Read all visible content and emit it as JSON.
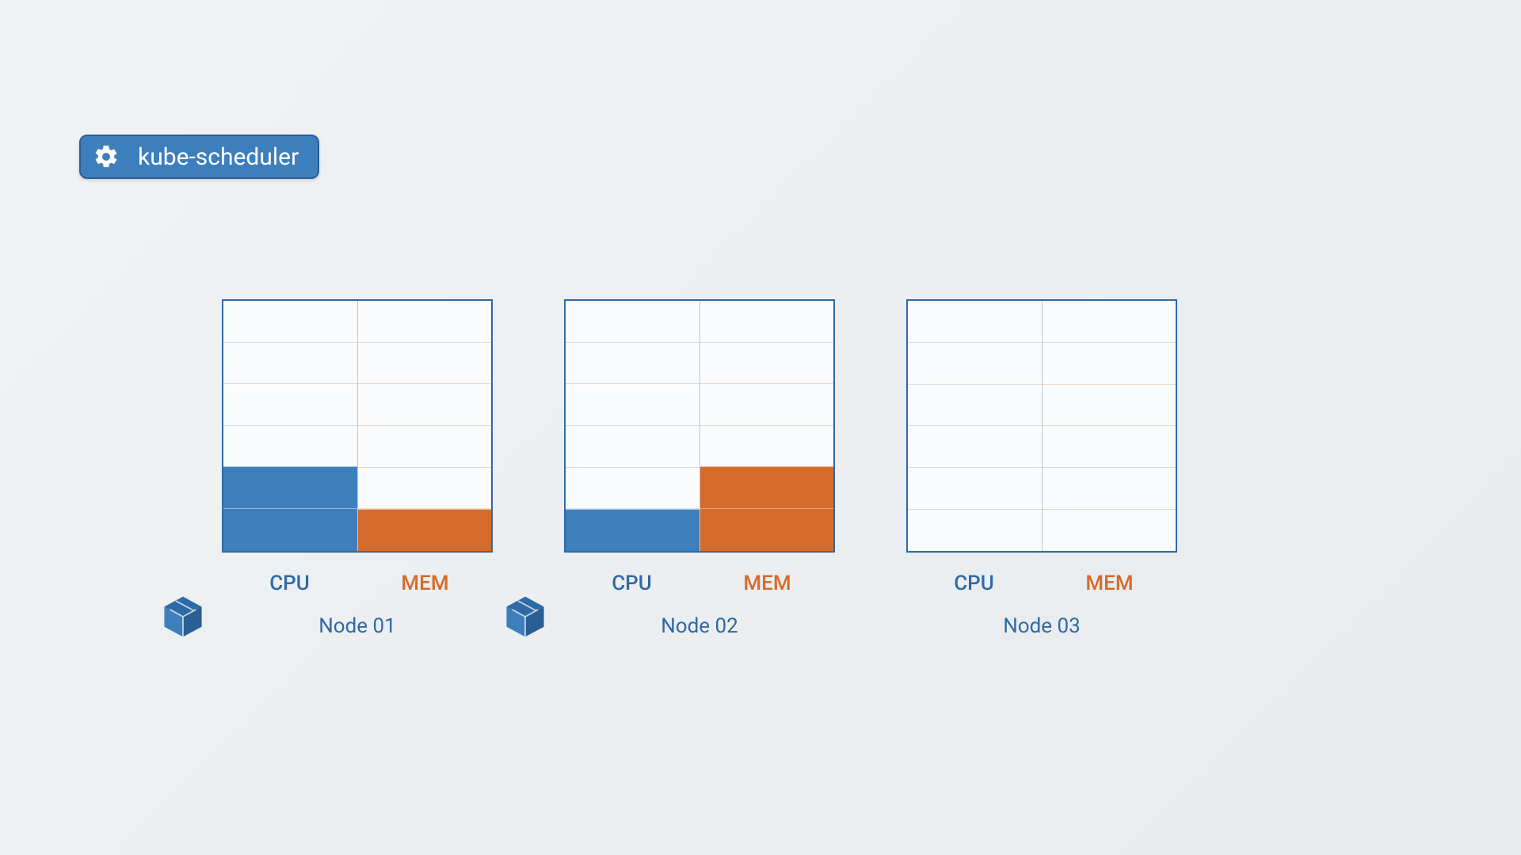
{
  "badge": {
    "label": "kube-scheduler"
  },
  "chart_data": {
    "type": "bar",
    "categories": [
      "Node 01",
      "Node 02",
      "Node 03"
    ],
    "series": [
      {
        "name": "CPU",
        "values": [
          2,
          1,
          0
        ]
      },
      {
        "name": "MEM",
        "values": [
          1,
          2,
          0
        ]
      }
    ],
    "ylim": [
      0,
      6
    ],
    "colors": {
      "cpu": "#3d7fbd",
      "mem": "#d66a2a"
    },
    "labels": {
      "cpu": "CPU",
      "mem": "MEM"
    }
  },
  "nodes": [
    {
      "name": "Node 01",
      "cpu": 2,
      "mem": 1,
      "hasPod": true
    },
    {
      "name": "Node 02",
      "cpu": 1,
      "mem": 2,
      "hasPod": true
    },
    {
      "name": "Node 03",
      "cpu": 0,
      "mem": 0,
      "hasPod": false
    }
  ],
  "capacity": 6
}
